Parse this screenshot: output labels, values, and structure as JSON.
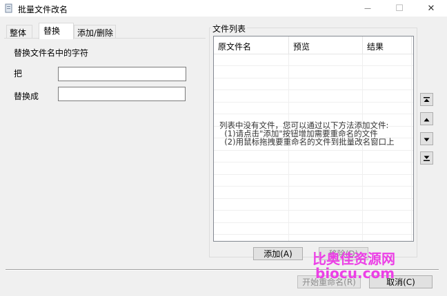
{
  "window": {
    "title": "批量文件改名",
    "minimize_glyph": "—",
    "maximize_glyph": "☐",
    "close_glyph": "✕"
  },
  "tabs": [
    {
      "label": "整体",
      "active": false
    },
    {
      "label": "替换",
      "active": true
    },
    {
      "label": "添加/删除",
      "active": false
    }
  ],
  "replace_panel": {
    "heading": "替换文件名中的字符",
    "find_label": "把",
    "find_value": "",
    "replace_label": "替换成",
    "replace_value": ""
  },
  "file_list": {
    "group_title": "文件列表",
    "columns": [
      "原文件名",
      "预览",
      "结果"
    ],
    "empty_message": [
      "列表中没有文件，您可以通过以下方法添加文件:",
      "  (1)请点击\"添加\"按钮增加需要重命名的文件",
      "  (2)用鼠标拖拽要重命名的文件到批量改名窗口上"
    ],
    "add_button": "添加(A)",
    "remove_button": "移除(D)"
  },
  "order_buttons": [
    "move-top-icon",
    "move-up-icon",
    "move-down-icon",
    "move-bottom-icon"
  ],
  "footer": {
    "start_button": "开始重命名(R)",
    "cancel_button": "取消(C)"
  },
  "watermark": {
    "line1": "比奥佳资源网",
    "line2": "biocu.com"
  },
  "colors": {
    "watermark": "#ec3fe6",
    "client_bg": "#f0f0f0"
  }
}
